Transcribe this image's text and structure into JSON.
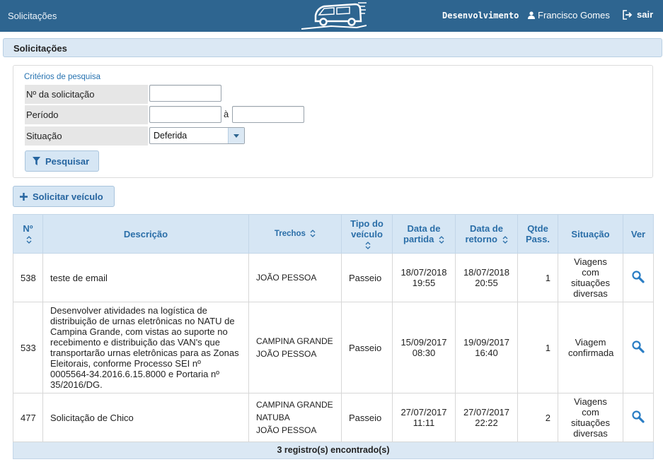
{
  "header": {
    "app_title": "Solicitações",
    "environment": "Desenvolvimento",
    "user_name": "Francisco Gomes",
    "logout_label": "sair",
    "accent_color": "#2e6590"
  },
  "section": {
    "title": "Solicitações"
  },
  "search": {
    "criteria_title": "Critérios de pesquisa",
    "request_number_label": "Nº da solicitação",
    "request_number_value": "",
    "period_label": "Período",
    "period_start_value": "",
    "period_separator": "à",
    "period_end_value": "",
    "status_label": "Situação",
    "status_value": "Deferida",
    "search_button": "Pesquisar"
  },
  "actions": {
    "request_vehicle_button": "Solicitar veículo"
  },
  "table": {
    "columns": {
      "num": "Nº",
      "description": "Descrição",
      "routes": "Trechos",
      "vehicle_type_1": "Tipo do",
      "vehicle_type_2": "veículo",
      "departure_1": "Data de",
      "departure_2": "partida",
      "return_1": "Data de",
      "return_2": "retorno",
      "passengers_1": "Qtde",
      "passengers_2": "Pass.",
      "status": "Situação",
      "view": "Ver"
    },
    "rows": [
      {
        "num": "538",
        "description": "teste de email",
        "routes": [
          "JOÃO PESSOA"
        ],
        "vehicle_type": "Passeio",
        "departure_date": "18/07/2018",
        "departure_time": "19:55",
        "return_date": "18/07/2018",
        "return_time": "20:55",
        "passengers": "1",
        "status": "Viagens com situações diversas"
      },
      {
        "num": "533",
        "description": "Desenvolver atividades na logística de distribuição de urnas eletrônicas no NATU de Campina Grande, com vistas ao suporte no recebimento e distribuição das VAN's que transportarão urnas eletrônicas para as Zonas Eleitorais, conforme Processo SEI nº 0005564-34.2016.6.15.8000 e Portaria nº 35/2016/DG.",
        "routes": [
          "CAMPINA GRANDE",
          "JOÃO PESSOA"
        ],
        "vehicle_type": "Passeio",
        "departure_date": "15/09/2017",
        "departure_time": "08:30",
        "return_date": "19/09/2017",
        "return_time": "16:40",
        "passengers": "1",
        "status": "Viagem confirmada"
      },
      {
        "num": "477",
        "description": "Solicitação de Chico",
        "routes": [
          "CAMPINA GRANDE",
          "NATUBA",
          "JOÃO PESSOA"
        ],
        "vehicle_type": "Passeio",
        "departure_date": "27/07/2017",
        "departure_time": "11:11",
        "return_date": "27/07/2017",
        "return_time": "22:22",
        "passengers": "2",
        "status": "Viagens com situações diversas"
      }
    ],
    "footer": "3 registro(s) encontrado(s)"
  }
}
